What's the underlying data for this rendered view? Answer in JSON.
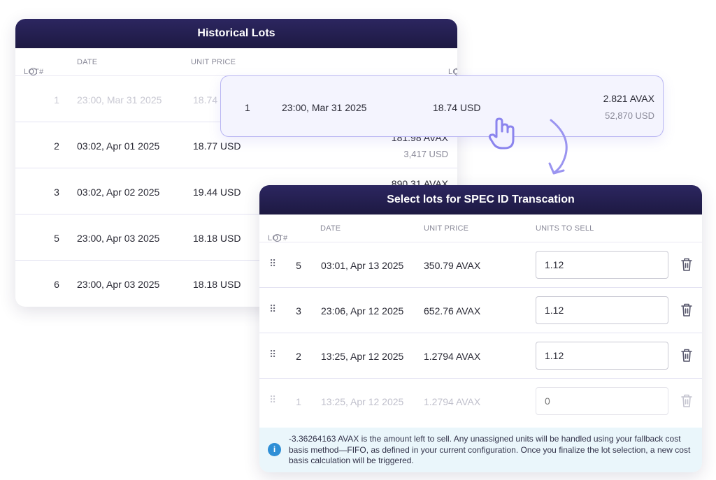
{
  "historical": {
    "title": "Historical Lots",
    "columns": {
      "lot": "LOT#",
      "date": "DATE",
      "unit_price": "UNIT PRICE",
      "lot_size": "LOT SIZE BEFORE"
    },
    "rows": [
      {
        "lot": "1",
        "date": "23:00, Mar 31 2025",
        "price": "18.74",
        "size": "",
        "usd": "",
        "faded": true
      },
      {
        "lot": "2",
        "date": "03:02, Apr 01 2025",
        "price": "18.77 USD",
        "size": "181.98 AVAX",
        "usd": "3,417 USD"
      },
      {
        "lot": "3",
        "date": "03:02, Apr 02 2025",
        "price": "19.44 USD",
        "size": "890.31 AVAX",
        "usd": ""
      },
      {
        "lot": "5",
        "date": "23:00, Apr 03 2025",
        "price": "18.18 USD",
        "size": "",
        "usd": ""
      },
      {
        "lot": "6",
        "date": "23:00, Apr 03 2025",
        "price": "18.18 USD",
        "size": "",
        "usd": ""
      }
    ]
  },
  "dragged_row": {
    "lot": "1",
    "date": "23:00, Mar 31 2025",
    "price": "18.74 USD",
    "size": "2.821 AVAX",
    "usd": "52,870 USD"
  },
  "select": {
    "title": "Select lots for SPEC ID Transcation",
    "columns": {
      "lot": "LOT#",
      "date": "DATE",
      "unit_price": "UNIT PRICE",
      "units": "UNITS TO SELL"
    },
    "rows": [
      {
        "lot": "5",
        "date": "03:01, Apr 13 2025",
        "price": "350.79 AVAX",
        "units": "1.12"
      },
      {
        "lot": "3",
        "date": "23:06, Apr 12 2025",
        "price": "652.76 AVAX",
        "units": "1.12"
      },
      {
        "lot": "2",
        "date": "13:25, Apr 12 2025",
        "price": "1.2794 AVAX",
        "units": "1.12"
      },
      {
        "lot": "1",
        "date": "13:25, Apr 12 2025",
        "price": "1.2794 AVAX",
        "units": "",
        "placeholder": "0",
        "faded": true
      }
    ],
    "notice": "-3.36264163 AVAX is the amount left to sell. Any unassigned units will be handled using your fallback cost basis method—FIFO, as defined in your current configuration. Once you finalize the lot selection, a new cost basis calculation will be triggered."
  },
  "icons": {
    "info": "info-icon",
    "grip": "drag-handle-icon",
    "trash": "trash-icon",
    "hand": "hand-cursor-icon",
    "arrow": "curved-arrow-icon"
  },
  "colors": {
    "header_bg": "#1d1942",
    "accent": "#8b84ee",
    "notice_bg": "#eaf6fb",
    "info_blue": "#2f8fd6"
  }
}
